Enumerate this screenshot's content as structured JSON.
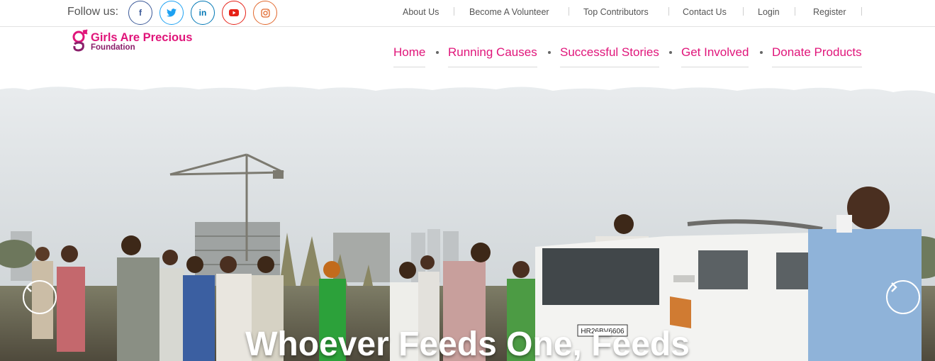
{
  "topbar": {
    "follow_label": "Follow us:",
    "social": [
      {
        "name": "facebook",
        "glyph": "f"
      },
      {
        "name": "twitter",
        "glyph": "t"
      },
      {
        "name": "linkedin",
        "glyph": "in"
      },
      {
        "name": "youtube",
        "glyph": "▶"
      },
      {
        "name": "instagram",
        "glyph": "◎"
      }
    ],
    "links": [
      "About Us",
      "Become A Volunteer",
      "Top Contributors",
      "Contact Us",
      "Login",
      "Register"
    ]
  },
  "logo": {
    "title": "Girls Are Precious",
    "subtitle": "Foundation"
  },
  "nav": {
    "items": [
      "Home",
      "Running Causes",
      "Successful Stories",
      "Get Involved",
      "Donate Products"
    ]
  },
  "hero": {
    "headline": "Whoever Feeds One, Feeds",
    "plate_text": "HR26BV6606"
  },
  "colors": {
    "brand": "#e0157a",
    "brand_dark": "#8a1f6a",
    "text_muted": "#555555"
  }
}
